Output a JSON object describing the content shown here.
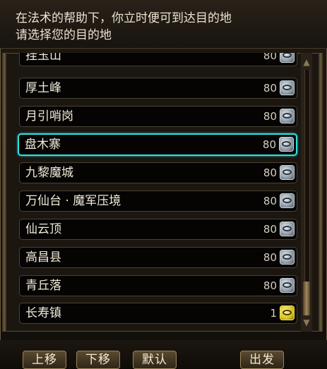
{
  "header": {
    "line1": "在法术的帮助下，你立时便可到达目的地",
    "line2": "请选择您的目的地"
  },
  "destinations": [
    {
      "name": "挂玉山",
      "level": "80",
      "icon": "silver-eye-icon"
    },
    {
      "name": "厚土峰",
      "level": "80",
      "icon": "silver-eye-icon"
    },
    {
      "name": "月引哨岗",
      "level": "80",
      "icon": "silver-eye-icon"
    },
    {
      "name": "盘木寨",
      "level": "80",
      "icon": "silver-eye-icon",
      "selected": true
    },
    {
      "name": "九黎魔城",
      "level": "80",
      "icon": "silver-eye-icon"
    },
    {
      "name": "万仙台 · 魔军压境",
      "level": "80",
      "icon": "silver-eye-icon"
    },
    {
      "name": "仙云顶",
      "level": "80",
      "icon": "silver-eye-icon"
    },
    {
      "name": "高昌县",
      "level": "80",
      "icon": "silver-eye-icon"
    },
    {
      "name": "青丘落",
      "level": "80",
      "icon": "silver-eye-icon"
    },
    {
      "name": "长寿镇",
      "level": "1",
      "icon": "gold-eye-icon"
    }
  ],
  "buttons": {
    "move_up": "上移",
    "move_down": "下移",
    "default": "默认",
    "depart": "出发"
  },
  "colors": {
    "selected_border": "#2fe0e0",
    "frame_gold": "#9a8458"
  }
}
